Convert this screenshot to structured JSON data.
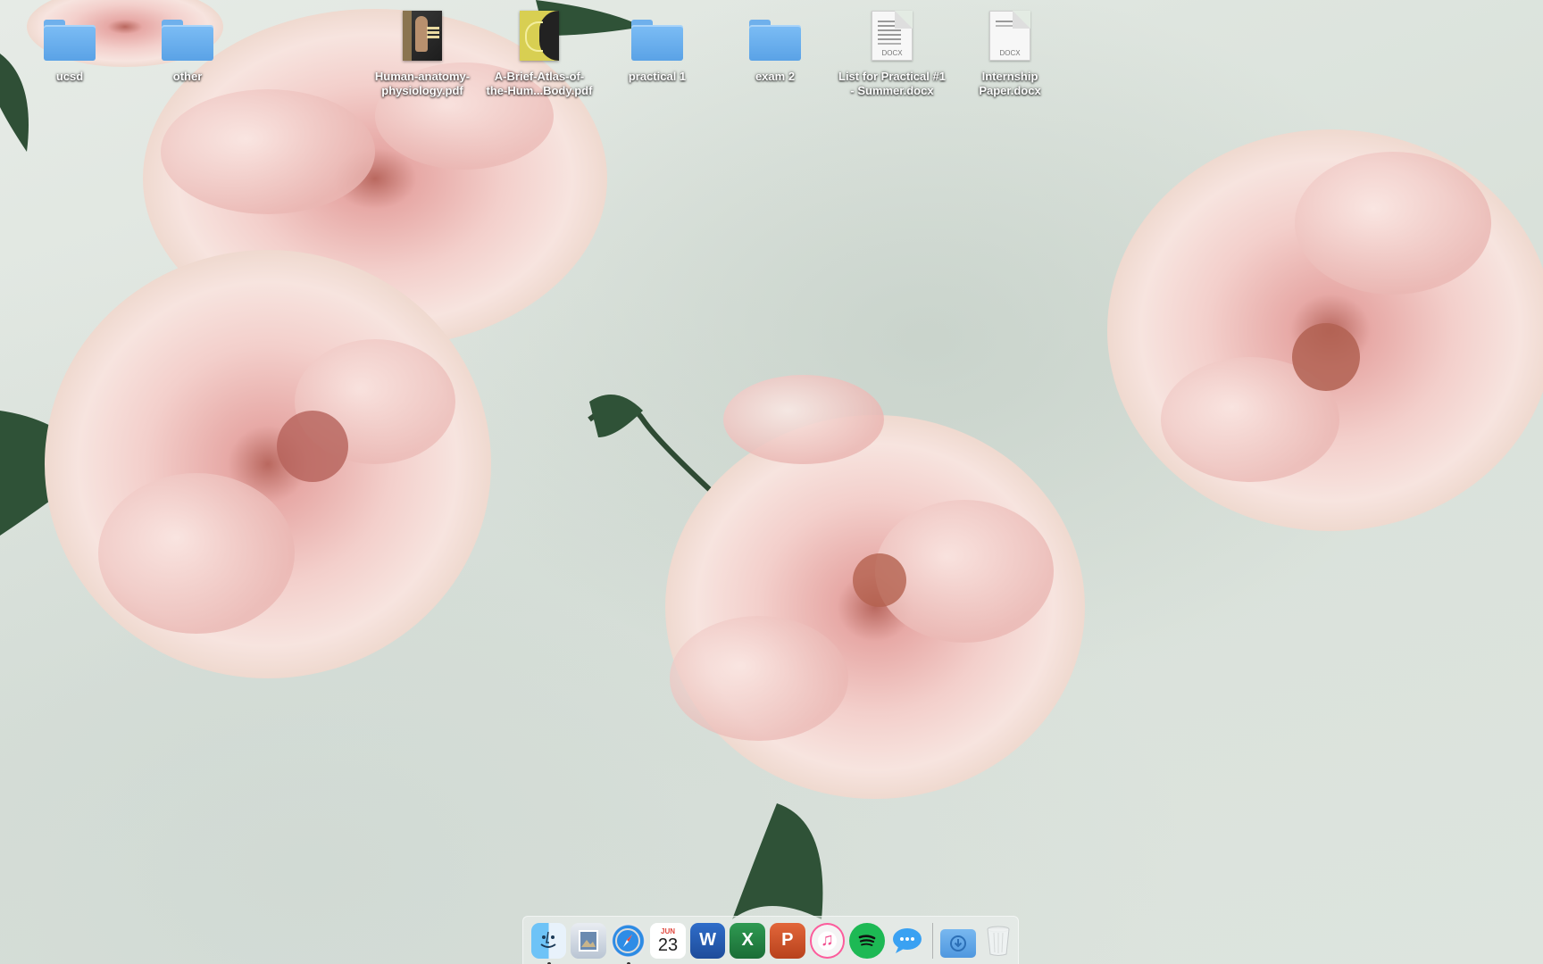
{
  "desktop": {
    "icons": [
      {
        "name": "ucsd",
        "type": "folder"
      },
      {
        "name": "other",
        "type": "folder"
      },
      {
        "name": "Human-anatomy-\nphysiology.pdf",
        "type": "pdf"
      },
      {
        "name": "A-Brief-Atlas-of-\nthe-Hum...Body.pdf",
        "type": "pdf"
      },
      {
        "name": "practical 1",
        "type": "folder"
      },
      {
        "name": "exam 2",
        "type": "folder"
      },
      {
        "name": "List for Practical #1\n- Summer.docx",
        "type": "docx"
      },
      {
        "name": "Internship\nPaper.docx",
        "type": "docx"
      }
    ],
    "doc_extension_label": "DOCX"
  },
  "dock": {
    "items": [
      {
        "app": "finder",
        "icon": "finder-icon",
        "running": true
      },
      {
        "app": "preview",
        "icon": "preview-icon",
        "running": false
      },
      {
        "app": "safari",
        "icon": "safari-compass-icon",
        "running": true
      },
      {
        "app": "calendar",
        "icon": "calendar-icon",
        "running": false
      },
      {
        "app": "word",
        "icon": "word-icon",
        "running": false
      },
      {
        "app": "excel",
        "icon": "excel-icon",
        "running": false
      },
      {
        "app": "powerpoint",
        "icon": "powerpoint-icon",
        "running": false
      },
      {
        "app": "itunes",
        "icon": "music-note-icon",
        "running": false
      },
      {
        "app": "spotify",
        "icon": "spotify-icon",
        "running": false
      },
      {
        "app": "messages",
        "icon": "speech-bubble-icon",
        "running": false
      },
      {
        "app": "downloads",
        "icon": "downloads-folder-icon",
        "running": false
      },
      {
        "app": "trash",
        "icon": "trash-icon",
        "running": false
      }
    ],
    "calendar_month": "JUN",
    "calendar_day": "23",
    "word_letter": "W",
    "excel_letter": "X",
    "powerpoint_letter": "P",
    "itunes_glyph": "♫"
  },
  "colors": {
    "folder_blue": "#6fb0ec",
    "wallpaper_base": "#dfe5df",
    "rose_pink": "#f2c9c6"
  }
}
